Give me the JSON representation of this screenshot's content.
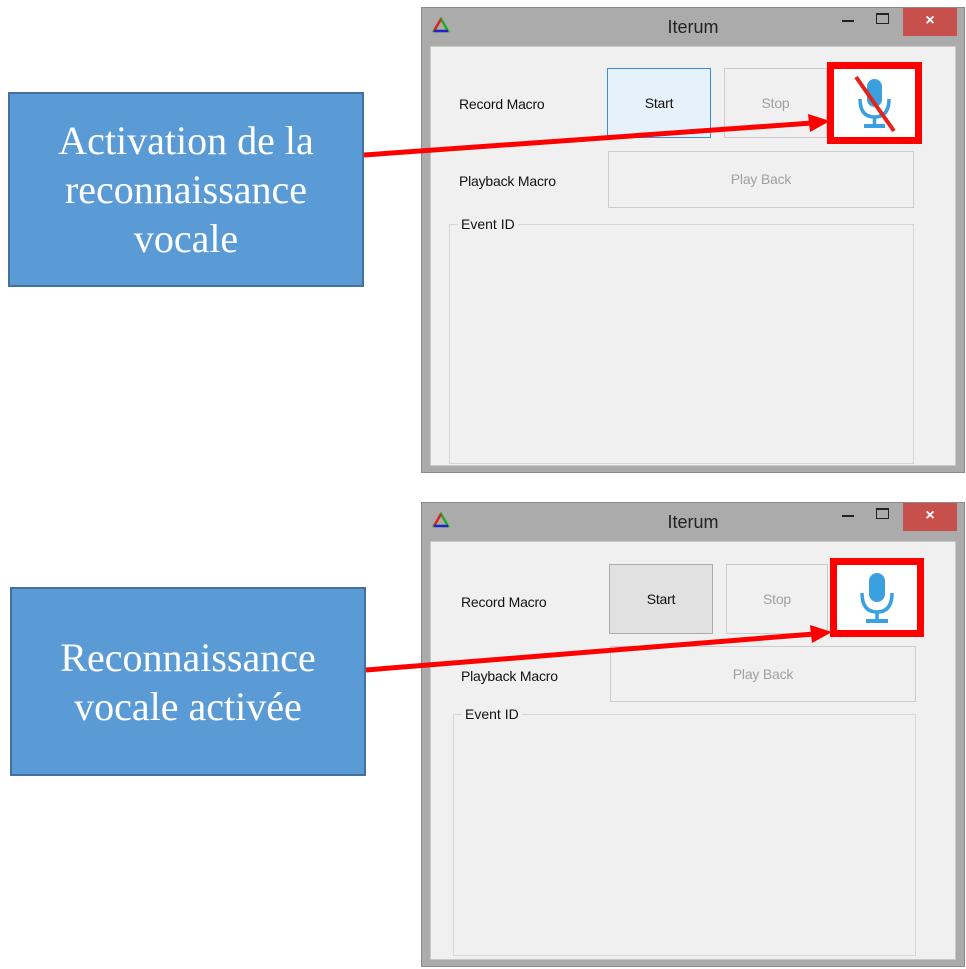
{
  "callouts": {
    "activation": {
      "line1": "Activation de la",
      "line2": "reconnaissance",
      "line3": "vocale"
    },
    "activated": {
      "line1": "Reconnaissance",
      "line2": "vocale activée"
    }
  },
  "window": {
    "title": "Iterum",
    "close_glyph": "×",
    "record_label": "Record Macro",
    "start_label": "Start",
    "stop_label": "Stop",
    "playback_label": "Playback Macro",
    "playback_button_label": "Play Back",
    "event_group_label": "Event ID"
  },
  "state": {
    "window1_mic": "microphone-muted-icon",
    "window2_mic": "microphone-icon"
  },
  "colors": {
    "callout_fill": "#5b9bd5",
    "arrow": "#ff0000",
    "highlight_border": "#ff0000",
    "mic_blue": "#3aa0e0",
    "close_button": "#c7504c"
  }
}
